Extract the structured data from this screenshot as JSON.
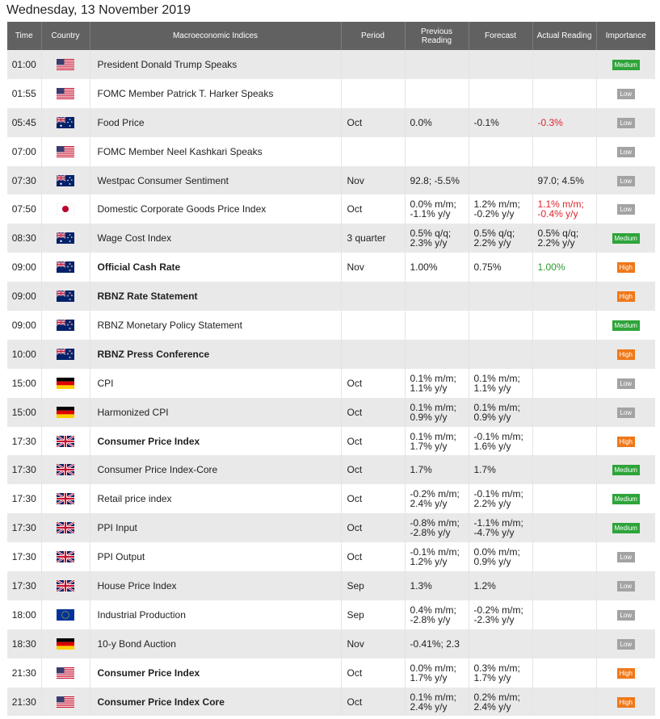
{
  "date_title": "Wednesday, 13 November 2019",
  "columns": {
    "time": "Time",
    "country": "Country",
    "indices": "Macroeconomic Indices",
    "period": "Period",
    "previous": "Previous Reading",
    "forecast": "Forecast",
    "actual": "Actual Reading",
    "importance": "Importance"
  },
  "colors": {
    "header_bg": "#616161",
    "row_alt": "#e9e9e9",
    "actual_down": "#e0242a",
    "actual_up": "#2e9a2e",
    "low": "#a3a3a3",
    "medium": "#2ea43a",
    "high": "#f07818"
  },
  "rows": [
    {
      "time": "01:00",
      "country": "us-flag-icon",
      "name": "President Donald Trump Speaks",
      "bold": false,
      "period": "",
      "previous": "",
      "forecast": "",
      "actual": "",
      "actual_color": "",
      "importance": "Medium"
    },
    {
      "time": "01:55",
      "country": "us-flag-icon",
      "name": "FOMC Member Patrick T. Harker Speaks",
      "bold": false,
      "period": "",
      "previous": "",
      "forecast": "",
      "actual": "",
      "actual_color": "",
      "importance": "Low"
    },
    {
      "time": "05:45",
      "country": "au-flag-icon",
      "name": "Food Price",
      "bold": false,
      "period": "Oct",
      "previous": "0.0%",
      "forecast": "-0.1%",
      "actual": "-0.3%",
      "actual_color": "red",
      "importance": "Low"
    },
    {
      "time": "07:00",
      "country": "us-flag-icon",
      "name": "FOMC Member Neel Kashkari Speaks",
      "bold": false,
      "period": "",
      "previous": "",
      "forecast": "",
      "actual": "",
      "actual_color": "",
      "importance": "Low"
    },
    {
      "time": "07:30",
      "country": "au-flag-icon",
      "name": "Westpac Consumer Sentiment",
      "bold": false,
      "period": "Nov",
      "previous": "92.8; -5.5%",
      "forecast": "",
      "actual": "97.0; 4.5%",
      "actual_color": "",
      "importance": "Low"
    },
    {
      "time": "07:50",
      "country": "jp-flag-icon",
      "name": "Domestic Corporate Goods Price Index",
      "bold": false,
      "period": "Oct",
      "previous": "0.0% m/m;\n-1.1% y/y",
      "forecast": "1.2% m/m;\n-0.2% y/y",
      "actual": "1.1% m/m;\n-0.4% y/y",
      "actual_color": "red",
      "importance": "Low"
    },
    {
      "time": "08:30",
      "country": "au-flag-icon",
      "name": "Wage Cost Index",
      "bold": false,
      "period": "3 quarter",
      "previous": "0.5% q/q;\n2.3% y/y",
      "forecast": "0.5% q/q;\n2.2% y/y",
      "actual": "0.5% q/q;\n2.2% y/y",
      "actual_color": "",
      "importance": "Medium"
    },
    {
      "time": "09:00",
      "country": "nz-flag-icon",
      "name": "Official Cash Rate",
      "bold": true,
      "period": "Nov",
      "previous": "1.00%",
      "forecast": "0.75%",
      "actual": "1.00%",
      "actual_color": "green",
      "importance": "High"
    },
    {
      "time": "09:00",
      "country": "nz-flag-icon",
      "name": "RBNZ Rate Statement",
      "bold": true,
      "period": "",
      "previous": "",
      "forecast": "",
      "actual": "",
      "actual_color": "",
      "importance": "High"
    },
    {
      "time": "09:00",
      "country": "nz-flag-icon",
      "name": "RBNZ Monetary Policy Statement",
      "bold": false,
      "period": "",
      "previous": "",
      "forecast": "",
      "actual": "",
      "actual_color": "",
      "importance": "Medium"
    },
    {
      "time": "10:00",
      "country": "nz-flag-icon",
      "name": "RBNZ Press Conference",
      "bold": true,
      "period": "",
      "previous": "",
      "forecast": "",
      "actual": "",
      "actual_color": "",
      "importance": "High"
    },
    {
      "time": "15:00",
      "country": "de-flag-icon",
      "name": "CPI",
      "bold": false,
      "period": "Oct",
      "previous": "0.1% m/m;\n1.1% y/y",
      "forecast": "0.1% m/m;\n1.1% y/y",
      "actual": "",
      "actual_color": "",
      "importance": "Low"
    },
    {
      "time": "15:00",
      "country": "de-flag-icon",
      "name": "Harmonized CPI",
      "bold": false,
      "period": "Oct",
      "previous": "0.1% m/m;\n0.9% y/y",
      "forecast": "0.1% m/m;\n0.9% y/y",
      "actual": "",
      "actual_color": "",
      "importance": "Low"
    },
    {
      "time": "17:30",
      "country": "uk-flag-icon",
      "name": "Consumer Price Index",
      "bold": true,
      "period": "Oct",
      "previous": "0.1% m/m;\n1.7% y/y",
      "forecast": "-0.1% m/m;\n1.6% y/y",
      "actual": "",
      "actual_color": "",
      "importance": "High"
    },
    {
      "time": "17:30",
      "country": "uk-flag-icon",
      "name": "Consumer Price Index-Core",
      "bold": false,
      "period": "Oct",
      "previous": "1.7%",
      "forecast": "1.7%",
      "actual": "",
      "actual_color": "",
      "importance": "Medium"
    },
    {
      "time": "17:30",
      "country": "uk-flag-icon",
      "name": "Retail price index",
      "bold": false,
      "period": "Oct",
      "previous": "-0.2% m/m;\n2.4% y/y",
      "forecast": "-0.1% m/m;\n2.2% y/y",
      "actual": "",
      "actual_color": "",
      "importance": "Medium"
    },
    {
      "time": "17:30",
      "country": "uk-flag-icon",
      "name": "PPI Input",
      "bold": false,
      "period": "Oct",
      "previous": "-0.8% m/m;\n-2.8% y/y",
      "forecast": "-1.1% m/m;\n-4.7% y/y",
      "actual": "",
      "actual_color": "",
      "importance": "Medium"
    },
    {
      "time": "17:30",
      "country": "uk-flag-icon",
      "name": "PPI Output",
      "bold": false,
      "period": "Oct",
      "previous": "-0.1% m/m;\n1.2% y/y",
      "forecast": "0.0% m/m;\n0.9% y/y",
      "actual": "",
      "actual_color": "",
      "importance": "Low"
    },
    {
      "time": "17:30",
      "country": "uk-flag-icon",
      "name": "House Price Index",
      "bold": false,
      "period": "Sep",
      "previous": "1.3%",
      "forecast": "1.2%",
      "actual": "",
      "actual_color": "",
      "importance": "Low"
    },
    {
      "time": "18:00",
      "country": "eu-flag-icon",
      "name": "Industrial Production",
      "bold": false,
      "period": "Sep",
      "previous": "0.4% m/m;\n-2.8% y/y",
      "forecast": "-0.2% m/m;\n-2.3% y/y",
      "actual": "",
      "actual_color": "",
      "importance": "Low"
    },
    {
      "time": "18:30",
      "country": "de-flag-icon",
      "name": "10-y Bond Auction",
      "bold": false,
      "period": "Nov",
      "previous": "-0.41%; 2.3",
      "forecast": "",
      "actual": "",
      "actual_color": "",
      "importance": "Low"
    },
    {
      "time": "21:30",
      "country": "us-flag-icon",
      "name": "Consumer Price Index",
      "bold": true,
      "period": "Oct",
      "previous": "0.0% m/m;\n1.7% y/y",
      "forecast": "0.3% m/m;\n1.7% y/y",
      "actual": "",
      "actual_color": "",
      "importance": "High"
    },
    {
      "time": "21:30",
      "country": "us-flag-icon",
      "name": "Consumer Price Index Core",
      "bold": true,
      "period": "Oct",
      "previous": "0.1% m/m;\n2.4% y/y",
      "forecast": "0.2% m/m;\n2.4% y/y",
      "actual": "",
      "actual_color": "",
      "importance": "High"
    }
  ]
}
